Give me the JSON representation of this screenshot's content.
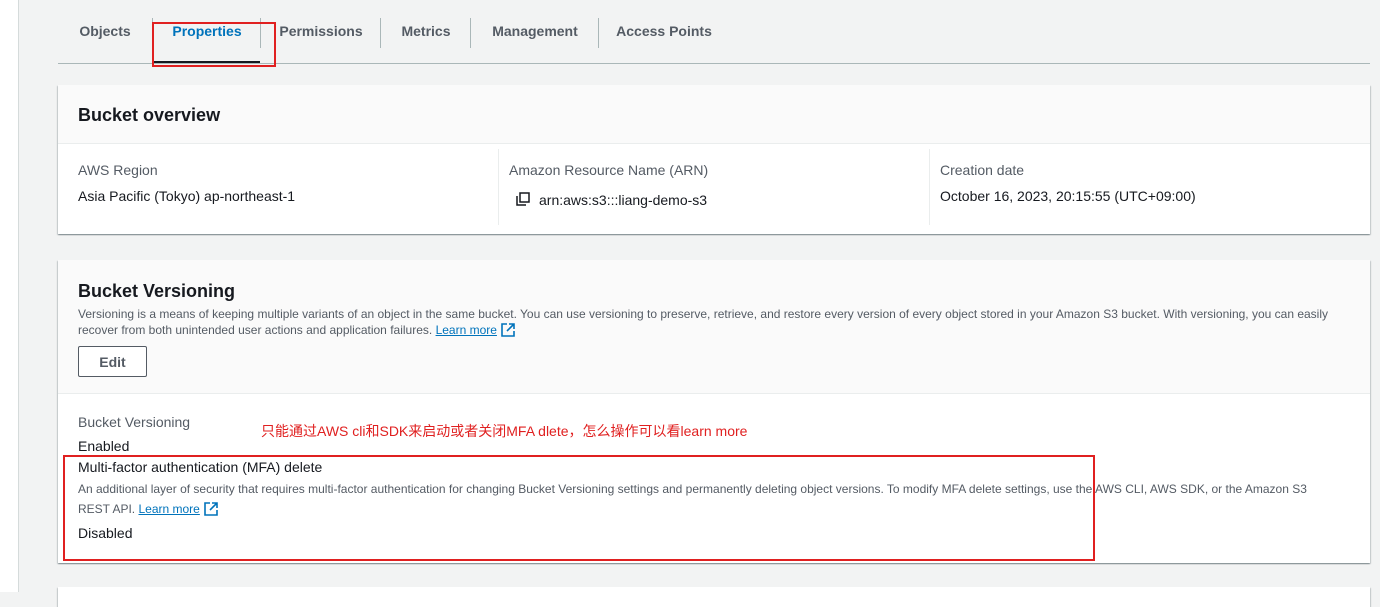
{
  "tabs": [
    {
      "label": "Objects"
    },
    {
      "label": "Properties"
    },
    {
      "label": "Permissions"
    },
    {
      "label": "Metrics"
    },
    {
      "label": "Management"
    },
    {
      "label": "Access Points"
    }
  ],
  "active_tab": "Properties",
  "overview": {
    "title": "Bucket overview",
    "region_label": "AWS Region",
    "region_value": "Asia Pacific (Tokyo) ap-northeast-1",
    "arn_label": "Amazon Resource Name (ARN)",
    "arn_value": "arn:aws:s3:::liang-demo-s3",
    "date_label": "Creation date",
    "date_value": "October 16, 2023, 20:15:55 (UTC+09:00)"
  },
  "versioning": {
    "title": "Bucket Versioning",
    "desc_line1": "Versioning is a means of keeping multiple variants of an object in the same bucket. You can use versioning to preserve, retrieve, and restore every version of every object stored in your Amazon S3 bucket. With versioning, you can easily",
    "desc_line2": "recover from both unintended user actions and application failures.",
    "learn_more": "Learn more",
    "edit_label": "Edit",
    "status_label": "Bucket Versioning",
    "status_value": "Enabled",
    "mfa_label": "Multi-factor authentication (MFA) delete",
    "mfa_desc_line1": "An additional layer of security that requires multi-factor authentication for changing Bucket Versioning settings and permanently deleting object versions. To modify MFA delete settings, use the AWS CLI, AWS SDK, or the Amazon S3",
    "mfa_desc_line2": "REST API.",
    "mfa_learn_more": "Learn more",
    "mfa_value": "Disabled"
  },
  "annotation": {
    "note": "只能通过AWS cli和SDK来启动或者关闭MFA dlete，怎么操作可以看learn more",
    "color": "#e02020"
  },
  "icons": [
    "copy-icon",
    "external-link-icon"
  ],
  "colors": {
    "link": "#0073bb",
    "text": "#16191f",
    "secondary": "#545b64",
    "annotation": "#e02020"
  }
}
